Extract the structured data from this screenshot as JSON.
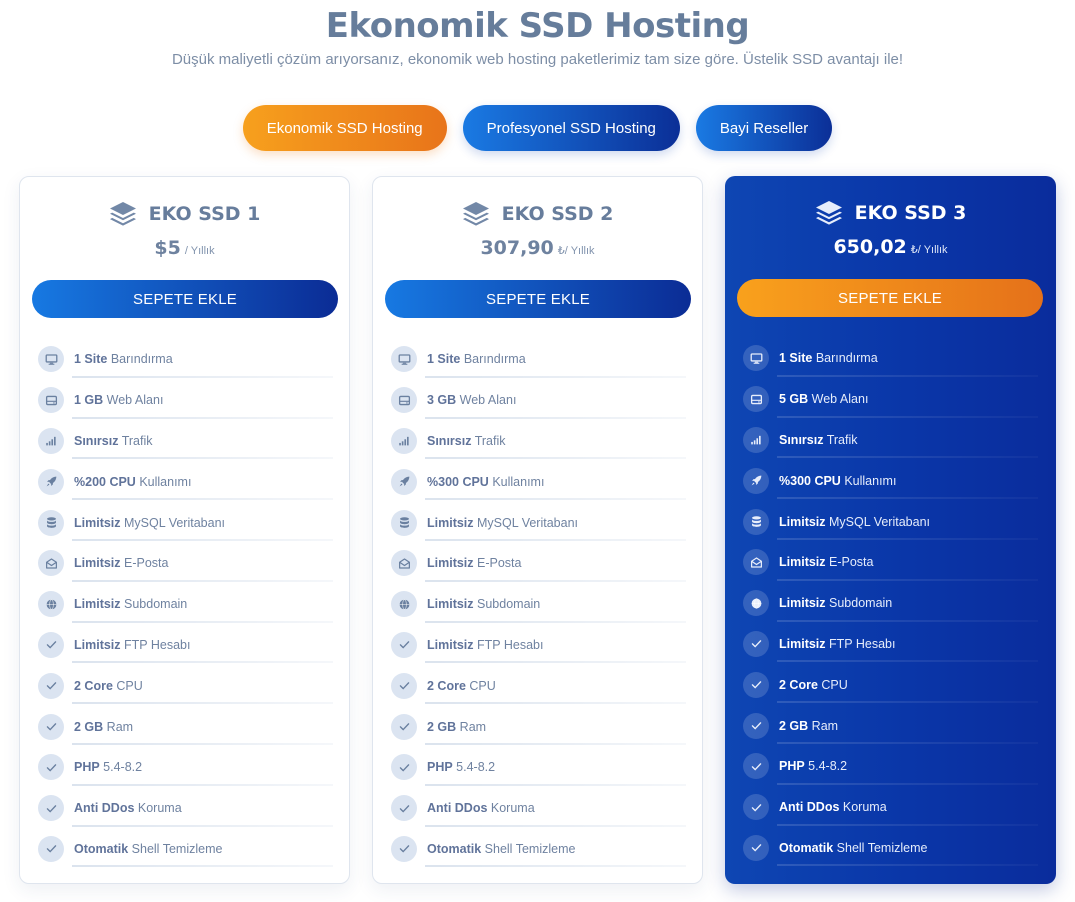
{
  "header": {
    "title": "Ekonomik SSD Hosting",
    "subtitle": "Düşük maliyetli çözüm arıyorsanız, ekonomik web hosting paketlerimiz tam size göre. Üstelik SSD avantajı ile!"
  },
  "tabs": [
    {
      "label": "Ekonomik SSD Hosting",
      "active": true
    },
    {
      "label": "Profesyonel SSD Hosting",
      "active": false
    },
    {
      "label": "Bayi Reseller",
      "active": false
    }
  ],
  "colors": {
    "accent_orange": "#f59a1d",
    "accent_blue": "#0b2f97",
    "featured_card": "#0a36a8",
    "text_muted": "#6f82a0"
  },
  "plans": [
    {
      "name": "EKO SSD 1",
      "price": "$5",
      "period": " / Yıllık",
      "cta": "SEPETE EKLE",
      "features": [
        {
          "icon": "monitor-icon",
          "bold": "1 Site",
          "text": " Barındırma"
        },
        {
          "icon": "hard-drive-icon",
          "bold": "1 GB",
          "text": " Web Alanı"
        },
        {
          "icon": "signal-icon",
          "bold": "Sınırsız",
          "text": " Trafik"
        },
        {
          "icon": "rocket-icon",
          "bold": "%200 CPU",
          "text": " Kullanımı"
        },
        {
          "icon": "database-icon",
          "bold": "Limitsiz",
          "text": " MySQL Veritabanı"
        },
        {
          "icon": "envelope-icon",
          "bold": "Limitsiz",
          "text": " E-Posta"
        },
        {
          "icon": "globe-icon",
          "bold": "Limitsiz",
          "text": " Subdomain"
        },
        {
          "icon": "check-icon",
          "bold": "Limitsiz",
          "text": " FTP Hesabı"
        },
        {
          "icon": "check-icon",
          "bold": "2 Core",
          "text": " CPU"
        },
        {
          "icon": "check-icon",
          "bold": "2 GB",
          "text": " Ram"
        },
        {
          "icon": "check-icon",
          "bold": "PHP",
          "text": " 5.4-8.2"
        },
        {
          "icon": "check-icon",
          "bold": "Anti DDos",
          "text": " Koruma"
        },
        {
          "icon": "check-icon",
          "bold": "Otomatik",
          "text": " Shell Temizleme"
        }
      ]
    },
    {
      "name": "EKO SSD 2",
      "price": "307,90",
      "period": "₺/ Yıllık",
      "cta": "SEPETE EKLE",
      "features": [
        {
          "icon": "monitor-icon",
          "bold": "1 Site",
          "text": " Barındırma"
        },
        {
          "icon": "hard-drive-icon",
          "bold": "3 GB",
          "text": " Web Alanı"
        },
        {
          "icon": "signal-icon",
          "bold": "Sınırsız",
          "text": " Trafik"
        },
        {
          "icon": "rocket-icon",
          "bold": "%300 CPU",
          "text": " Kullanımı"
        },
        {
          "icon": "database-icon",
          "bold": "Limitsiz",
          "text": " MySQL Veritabanı"
        },
        {
          "icon": "envelope-icon",
          "bold": "Limitsiz",
          "text": " E-Posta"
        },
        {
          "icon": "globe-icon",
          "bold": "Limitsiz",
          "text": " Subdomain"
        },
        {
          "icon": "check-icon",
          "bold": "Limitsiz",
          "text": " FTP Hesabı"
        },
        {
          "icon": "check-icon",
          "bold": "2 Core",
          "text": " CPU"
        },
        {
          "icon": "check-icon",
          "bold": "2 GB",
          "text": " Ram"
        },
        {
          "icon": "check-icon",
          "bold": "PHP",
          "text": " 5.4-8.2"
        },
        {
          "icon": "check-icon",
          "bold": "Anti DDos",
          "text": " Koruma"
        },
        {
          "icon": "check-icon",
          "bold": "Otomatik",
          "text": " Shell Temizleme"
        }
      ]
    },
    {
      "name": "EKO SSD 3",
      "price": "650,02",
      "period": "₺/ Yıllık",
      "cta": "SEPETE EKLE",
      "features": [
        {
          "icon": "monitor-icon",
          "bold": "1 Site",
          "text": " Barındırma"
        },
        {
          "icon": "hard-drive-icon",
          "bold": "5 GB",
          "text": " Web Alanı"
        },
        {
          "icon": "signal-icon",
          "bold": "Sınırsız",
          "text": " Trafik"
        },
        {
          "icon": "rocket-icon",
          "bold": "%300 CPU",
          "text": " Kullanımı"
        },
        {
          "icon": "database-icon",
          "bold": "Limitsiz",
          "text": " MySQL Veritabanı"
        },
        {
          "icon": "envelope-icon",
          "bold": "Limitsiz",
          "text": " E-Posta"
        },
        {
          "icon": "globe-icon",
          "bold": "Limitsiz",
          "text": " Subdomain"
        },
        {
          "icon": "check-icon",
          "bold": "Limitsiz",
          "text": " FTP Hesabı"
        },
        {
          "icon": "check-icon",
          "bold": "2 Core",
          "text": " CPU"
        },
        {
          "icon": "check-icon",
          "bold": "2 GB",
          "text": " Ram"
        },
        {
          "icon": "check-icon",
          "bold": "PHP",
          "text": " 5.4-8.2"
        },
        {
          "icon": "check-icon",
          "bold": "Anti DDos",
          "text": " Koruma"
        },
        {
          "icon": "check-icon",
          "bold": "Otomatik",
          "text": " Shell Temizleme"
        }
      ]
    }
  ]
}
